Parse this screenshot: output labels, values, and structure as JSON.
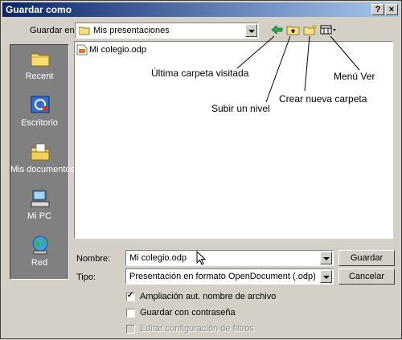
{
  "window": {
    "title": "Guardar como",
    "help_label": "?",
    "close_label": "×"
  },
  "toolbar": {
    "save_in_label": "Guardar en:",
    "current_folder": "Mis presentaciones"
  },
  "places": [
    {
      "label": "Recent",
      "icon": "recent-folder-icon"
    },
    {
      "label": "Escritorio",
      "icon": "desktop-icon"
    },
    {
      "label": "Mis documentos",
      "icon": "my-documents-icon"
    },
    {
      "label": "Mi PC",
      "icon": "my-computer-icon"
    },
    {
      "label": "Red",
      "icon": "network-icon"
    }
  ],
  "files": [
    {
      "name": "Mi colegio.odp",
      "icon": "odp-file-icon"
    }
  ],
  "annotations": {
    "last_folder": "Última carpeta visitada",
    "up_level": "Subir un nivel",
    "new_folder": "Crear nueva carpeta",
    "view_menu": "Menú Ver"
  },
  "form": {
    "name_label": "Nombre:",
    "name_value": "Mi colegio.odp",
    "type_label": "Tipo:",
    "type_value": "Presentación en formato OpenDocument (.odp)"
  },
  "buttons": {
    "save": "Guardar",
    "cancel": "Cancelar"
  },
  "options": {
    "auto_ext": {
      "label": "Ampliación aut. nombre de archivo",
      "checked": true
    },
    "password": {
      "label": "Guardar con contraseña",
      "checked": false
    },
    "filters": {
      "label": "Editar configuración de filtros",
      "checked": false,
      "disabled": true
    }
  },
  "colors": {
    "titlebar_start": "#0a246a",
    "titlebar_end": "#a6caf0",
    "dialog_bg": "#d4d0c8",
    "places_bg": "#808080"
  }
}
